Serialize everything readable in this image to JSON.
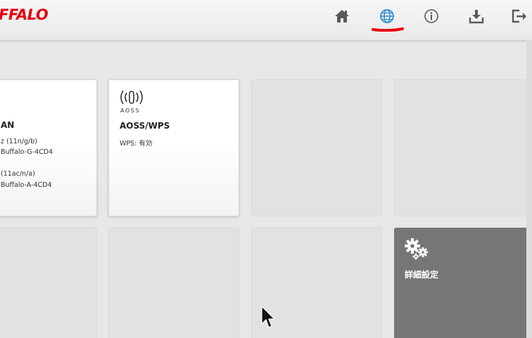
{
  "header": {
    "logo_text": "FFALO",
    "nav": [
      {
        "name": "home-icon",
        "label": "home"
      },
      {
        "name": "globe-icon",
        "label": "internet"
      },
      {
        "name": "info-icon",
        "label": "info"
      },
      {
        "name": "download-icon",
        "label": "download"
      },
      {
        "name": "logout-icon",
        "label": "logout"
      }
    ],
    "active_nav": "globe-icon",
    "active_underline_color": "#e60012"
  },
  "tiles": {
    "wireless": {
      "title": "AN",
      "line1": "z (11n/g/b)",
      "line2": "Buffalo-G-4CD4",
      "line3": "(11ac/n/a)",
      "line4": "Buffalo-A-4CD4"
    },
    "aoss": {
      "icon_caption": "AOSS",
      "title": "AOSS/WPS",
      "status": "WPS: 有効"
    },
    "advanced": {
      "title": "詳細設定",
      "icon": "gears-icon"
    }
  },
  "colors": {
    "brand": "#e60012",
    "icon_gray": "#5a5a5a",
    "globe_blue": "#2a8ad8",
    "dark_tile": "#767676"
  }
}
